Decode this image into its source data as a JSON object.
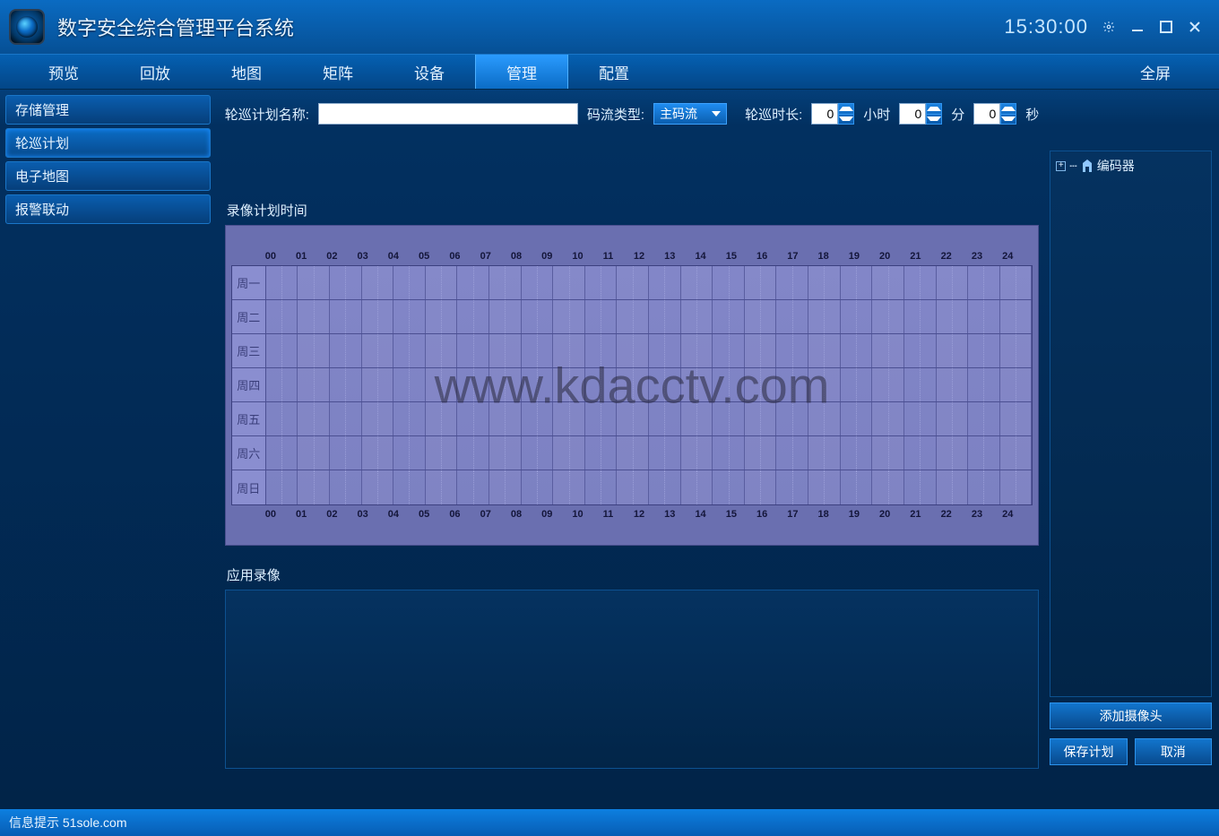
{
  "title": "数字安全综合管理平台系统",
  "clock": "15:30:00",
  "nav": {
    "items": [
      "预览",
      "回放",
      "地图",
      "矩阵",
      "设备",
      "管理",
      "配置"
    ],
    "active": 5,
    "fullscreen": "全屏"
  },
  "sidebar": {
    "items": [
      "存储管理",
      "轮巡计划",
      "电子地图",
      "报警联动"
    ],
    "active": 1
  },
  "form": {
    "name_label": "轮巡计划名称:",
    "name_value": "",
    "stream_label": "码流类型:",
    "stream_value": "主码流",
    "duration_label": "轮巡时长:",
    "hours_value": "0",
    "hours_unit": "小时",
    "minutes_value": "0",
    "minutes_unit": "分",
    "seconds_value": "0",
    "seconds_unit": "秒"
  },
  "schedule": {
    "title": "录像计划时间",
    "hours": [
      "00",
      "01",
      "02",
      "03",
      "04",
      "05",
      "06",
      "07",
      "08",
      "09",
      "10",
      "11",
      "12",
      "13",
      "14",
      "15",
      "16",
      "17",
      "18",
      "19",
      "20",
      "21",
      "22",
      "23",
      "24"
    ],
    "days": [
      "周一",
      "周二",
      "周三",
      "周四",
      "周五",
      "周六",
      "周日"
    ]
  },
  "apply": {
    "title": "应用录像"
  },
  "tree": {
    "root": "编码器"
  },
  "buttons": {
    "add_camera": "添加摄像头",
    "save": "保存计划",
    "cancel": "取消"
  },
  "status": {
    "text": "信息提示  51sole.com"
  },
  "watermark": "www.kdacctv.com"
}
